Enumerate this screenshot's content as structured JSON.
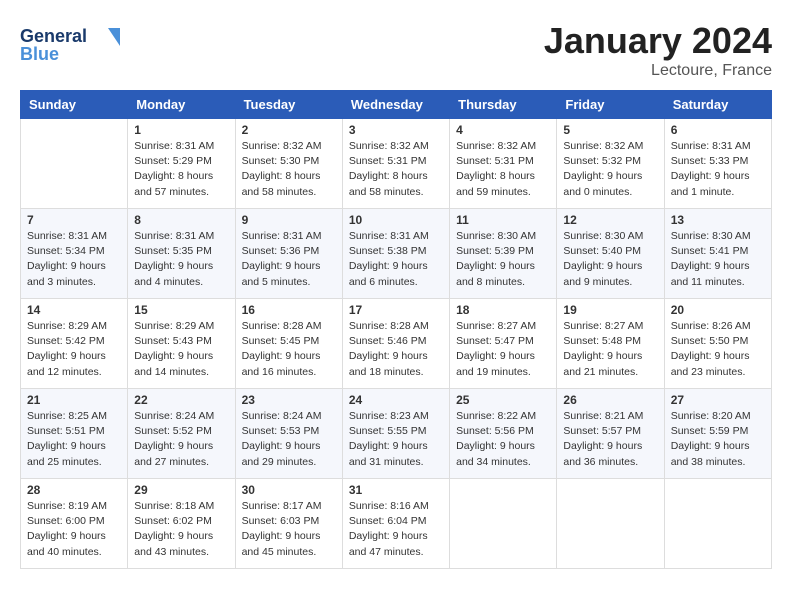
{
  "header": {
    "logo_line1": "General",
    "logo_line2": "Blue",
    "month": "January 2024",
    "location": "Lectoure, France"
  },
  "weekdays": [
    "Sunday",
    "Monday",
    "Tuesday",
    "Wednesday",
    "Thursday",
    "Friday",
    "Saturday"
  ],
  "weeks": [
    [
      {
        "day": "",
        "empty": true
      },
      {
        "day": "1",
        "sunrise": "8:31 AM",
        "sunset": "5:29 PM",
        "daylight": "8 hours and 57 minutes."
      },
      {
        "day": "2",
        "sunrise": "8:32 AM",
        "sunset": "5:30 PM",
        "daylight": "8 hours and 58 minutes."
      },
      {
        "day": "3",
        "sunrise": "8:32 AM",
        "sunset": "5:31 PM",
        "daylight": "8 hours and 58 minutes."
      },
      {
        "day": "4",
        "sunrise": "8:32 AM",
        "sunset": "5:31 PM",
        "daylight": "8 hours and 59 minutes."
      },
      {
        "day": "5",
        "sunrise": "8:32 AM",
        "sunset": "5:32 PM",
        "daylight": "9 hours and 0 minutes."
      },
      {
        "day": "6",
        "sunrise": "8:31 AM",
        "sunset": "5:33 PM",
        "daylight": "9 hours and 1 minute."
      }
    ],
    [
      {
        "day": "7",
        "sunrise": "8:31 AM",
        "sunset": "5:34 PM",
        "daylight": "9 hours and 3 minutes."
      },
      {
        "day": "8",
        "sunrise": "8:31 AM",
        "sunset": "5:35 PM",
        "daylight": "9 hours and 4 minutes."
      },
      {
        "day": "9",
        "sunrise": "8:31 AM",
        "sunset": "5:36 PM",
        "daylight": "9 hours and 5 minutes."
      },
      {
        "day": "10",
        "sunrise": "8:31 AM",
        "sunset": "5:38 PM",
        "daylight": "9 hours and 6 minutes."
      },
      {
        "day": "11",
        "sunrise": "8:30 AM",
        "sunset": "5:39 PM",
        "daylight": "9 hours and 8 minutes."
      },
      {
        "day": "12",
        "sunrise": "8:30 AM",
        "sunset": "5:40 PM",
        "daylight": "9 hours and 9 minutes."
      },
      {
        "day": "13",
        "sunrise": "8:30 AM",
        "sunset": "5:41 PM",
        "daylight": "9 hours and 11 minutes."
      }
    ],
    [
      {
        "day": "14",
        "sunrise": "8:29 AM",
        "sunset": "5:42 PM",
        "daylight": "9 hours and 12 minutes."
      },
      {
        "day": "15",
        "sunrise": "8:29 AM",
        "sunset": "5:43 PM",
        "daylight": "9 hours and 14 minutes."
      },
      {
        "day": "16",
        "sunrise": "8:28 AM",
        "sunset": "5:45 PM",
        "daylight": "9 hours and 16 minutes."
      },
      {
        "day": "17",
        "sunrise": "8:28 AM",
        "sunset": "5:46 PM",
        "daylight": "9 hours and 18 minutes."
      },
      {
        "day": "18",
        "sunrise": "8:27 AM",
        "sunset": "5:47 PM",
        "daylight": "9 hours and 19 minutes."
      },
      {
        "day": "19",
        "sunrise": "8:27 AM",
        "sunset": "5:48 PM",
        "daylight": "9 hours and 21 minutes."
      },
      {
        "day": "20",
        "sunrise": "8:26 AM",
        "sunset": "5:50 PM",
        "daylight": "9 hours and 23 minutes."
      }
    ],
    [
      {
        "day": "21",
        "sunrise": "8:25 AM",
        "sunset": "5:51 PM",
        "daylight": "9 hours and 25 minutes."
      },
      {
        "day": "22",
        "sunrise": "8:24 AM",
        "sunset": "5:52 PM",
        "daylight": "9 hours and 27 minutes."
      },
      {
        "day": "23",
        "sunrise": "8:24 AM",
        "sunset": "5:53 PM",
        "daylight": "9 hours and 29 minutes."
      },
      {
        "day": "24",
        "sunrise": "8:23 AM",
        "sunset": "5:55 PM",
        "daylight": "9 hours and 31 minutes."
      },
      {
        "day": "25",
        "sunrise": "8:22 AM",
        "sunset": "5:56 PM",
        "daylight": "9 hours and 34 minutes."
      },
      {
        "day": "26",
        "sunrise": "8:21 AM",
        "sunset": "5:57 PM",
        "daylight": "9 hours and 36 minutes."
      },
      {
        "day": "27",
        "sunrise": "8:20 AM",
        "sunset": "5:59 PM",
        "daylight": "9 hours and 38 minutes."
      }
    ],
    [
      {
        "day": "28",
        "sunrise": "8:19 AM",
        "sunset": "6:00 PM",
        "daylight": "9 hours and 40 minutes."
      },
      {
        "day": "29",
        "sunrise": "8:18 AM",
        "sunset": "6:02 PM",
        "daylight": "9 hours and 43 minutes."
      },
      {
        "day": "30",
        "sunrise": "8:17 AM",
        "sunset": "6:03 PM",
        "daylight": "9 hours and 45 minutes."
      },
      {
        "day": "31",
        "sunrise": "8:16 AM",
        "sunset": "6:04 PM",
        "daylight": "9 hours and 47 minutes."
      },
      {
        "day": "",
        "empty": true
      },
      {
        "day": "",
        "empty": true
      },
      {
        "day": "",
        "empty": true
      }
    ]
  ],
  "labels": {
    "sunrise": "Sunrise:",
    "sunset": "Sunset:",
    "daylight": "Daylight:"
  }
}
